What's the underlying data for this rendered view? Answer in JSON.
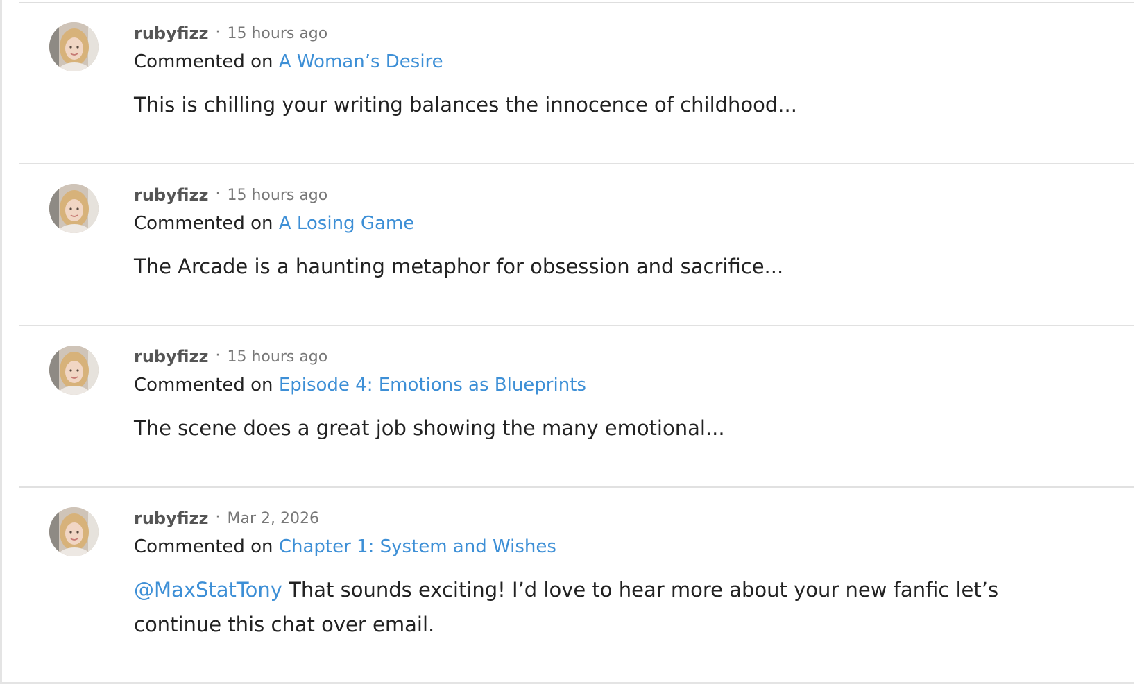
{
  "feed": {
    "items": [
      {
        "username": "rubyfizz",
        "separator": "·",
        "timestamp": "15 hours ago",
        "action": "Commented on",
        "target": "A Woman’s Desire",
        "mention": "",
        "body": "This is chilling your writing balances the innocence of childhood..."
      },
      {
        "username": "rubyfizz",
        "separator": "·",
        "timestamp": "15 hours ago",
        "action": "Commented on",
        "target": "A Losing Game",
        "mention": "",
        "body": "The Arcade is a haunting metaphor for obsession and sacrifice..."
      },
      {
        "username": "rubyfizz",
        "separator": "·",
        "timestamp": "15 hours ago",
        "action": "Commented on",
        "target": "Episode 4: Emotions as Blueprints",
        "mention": "",
        "body": "The scene does a great job showing the many emotional..."
      },
      {
        "username": "rubyfizz",
        "separator": "·",
        "timestamp": "Mar 2, 2026",
        "action": "Commented on",
        "target": "Chapter 1: System and Wishes",
        "mention": "@MaxStatTony",
        "body": " That sounds exciting! I’d love to hear more about your new fanfic let’s continue this chat over email."
      }
    ]
  },
  "colors": {
    "link": "#3d8fd6",
    "username": "#555555",
    "timestamp": "#777777",
    "text": "#222222",
    "divider": "#e1e1e1"
  },
  "icons": {
    "avatar": "user-avatar-photo"
  }
}
